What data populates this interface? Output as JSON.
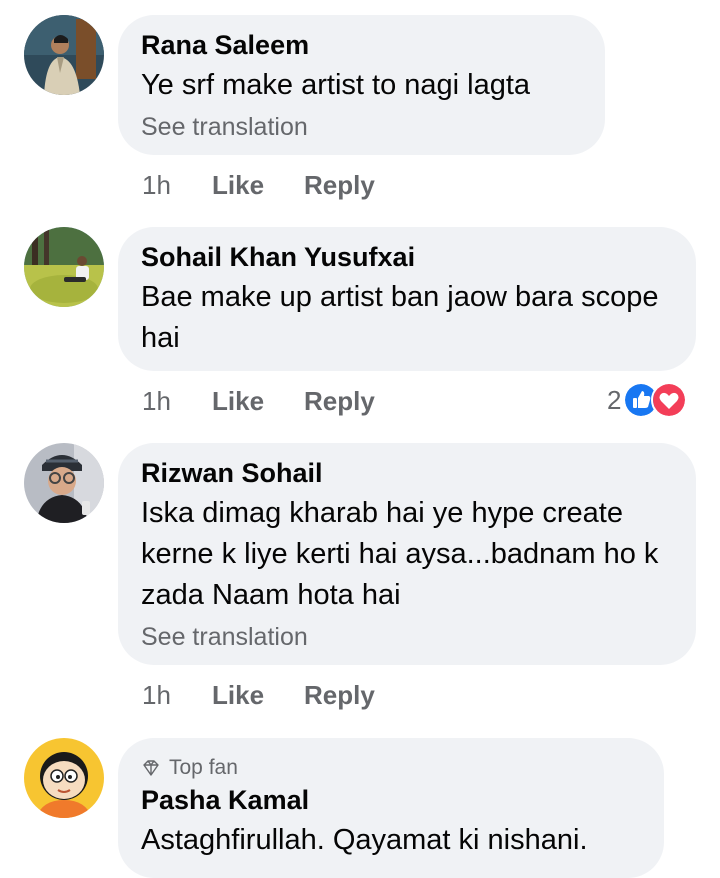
{
  "comments": [
    {
      "author": "Rana Saleem",
      "text": "Ye srf make artist to nagi lagta",
      "see_translation": "See translation",
      "time": "1h",
      "like": "Like",
      "reply": "Reply"
    },
    {
      "author": "Sohail Khan Yusufxai",
      "text": "Bae make up artist ban jaow bara scope hai",
      "time": "1h",
      "like": "Like",
      "reply": "Reply",
      "reaction_count": "2",
      "reaction_icons": [
        "like-reaction-icon",
        "love-reaction-icon"
      ]
    },
    {
      "author": "Rizwan Sohail",
      "text": "Iska dimag kharab hai ye hype create kerne k liye kerti hai aysa...badnam ho k zada Naam hota hai",
      "see_translation": "See translation",
      "time": "1h",
      "like": "Like",
      "reply": "Reply"
    },
    {
      "badge": "Top fan",
      "author": "Pasha Kamal",
      "text": "Astaghfirullah. Qayamat ki nishani."
    }
  ],
  "colors": {
    "bubble": "#f0f2f5",
    "secondary_text": "#65676b",
    "like_blue": "#1877f2",
    "love_red": "#f33e58"
  }
}
